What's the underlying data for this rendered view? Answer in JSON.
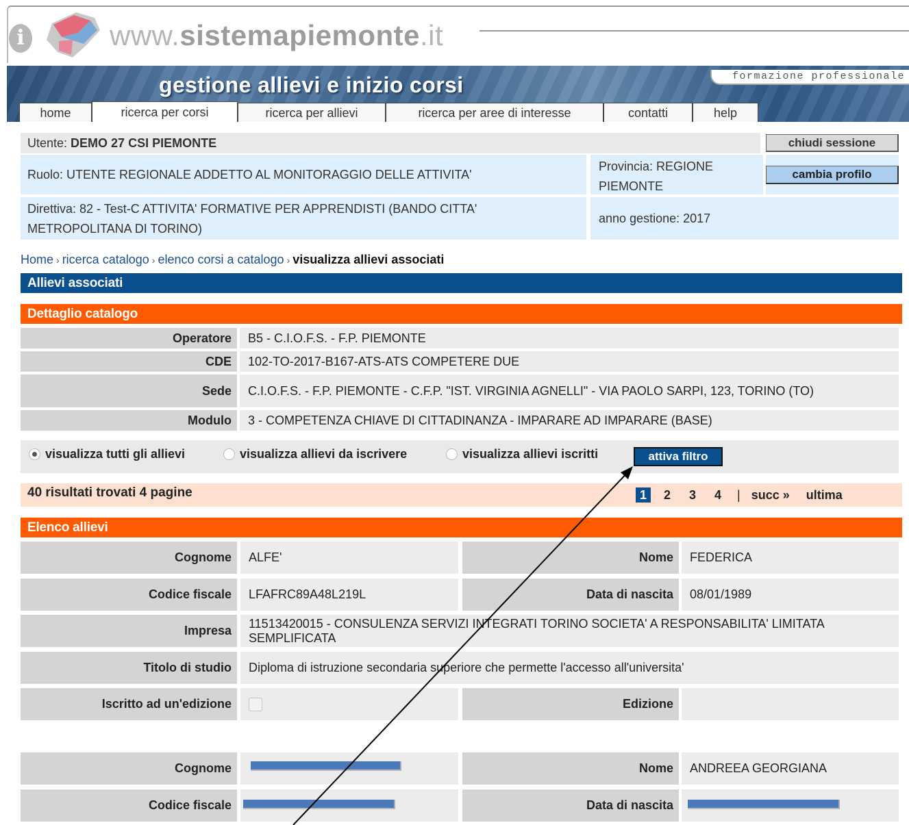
{
  "header": {
    "site_name_prefix": "www.",
    "site_name_bold": "sistemapiemonte",
    "site_name_suffix": ".it",
    "banner_title": "gestione allievi e inizio corsi",
    "banner_tag": "formazione professionale"
  },
  "tabs": [
    {
      "label": "home"
    },
    {
      "label": "ricerca per corsi"
    },
    {
      "label": "ricerca per allievi"
    },
    {
      "label": "ricerca per aree di interesse"
    },
    {
      "label": "contatti"
    },
    {
      "label": "help"
    }
  ],
  "user": {
    "utente_label": "Utente: ",
    "utente_value": "DEMO 27 CSI PIEMONTE",
    "chiudi_label": "chiudi sessione",
    "ruolo": "Ruolo: UTENTE REGIONALE ADDETTO AL MONITORAGGIO DELLE ATTIVITA'",
    "provincia": "Provincia: REGIONE PIEMONTE",
    "cambia_label": "cambia profilo",
    "direttiva": "Direttiva: 82 - Test-C ATTIVITA' FORMATIVE PER APPRENDISTI (BANDO CITTA' METROPOLITANA DI TORINO)",
    "anno": "anno gestione: 2017"
  },
  "breadcrumb": {
    "home": "Home",
    "ricerca": "ricerca catalogo",
    "elenco": "elenco corsi a catalogo",
    "current": "visualizza allievi associati",
    "sep": "›"
  },
  "sections": {
    "allievi_associati": "Allievi associati",
    "dettaglio_catalogo": "Dettaglio catalogo",
    "elenco_allievi": "Elenco allievi"
  },
  "detail": {
    "operatore_label": "Operatore",
    "operatore_value": "B5 - C.I.O.F.S. - F.P. PIEMONTE",
    "cde_label": "CDE",
    "cde_value": "102-TO-2017-B167-ATS-ATS COMPETERE DUE",
    "sede_label": "Sede",
    "sede_value": "C.I.O.F.S. - F.P. PIEMONTE - C.F.P. \"IST. VIRGINIA AGNELLI\" - VIA PAOLO SARPI, 123, TORINO (TO)",
    "modulo_label": "Modulo",
    "modulo_value": "3 - COMPETENZA CHIAVE DI CITTADINANZA - IMPARARE AD IMPARARE (BASE)"
  },
  "filter": {
    "opt_tutti": "visualizza tutti gli allievi",
    "opt_da_iscrivere": "visualizza allievi da iscrivere",
    "opt_iscritti": "visualizza allievi iscritti",
    "selected": "tutti",
    "button": "attiva filtro"
  },
  "results": {
    "text": "40 risultati trovati 4  pagine",
    "pages": [
      "1",
      "2",
      "3",
      "4"
    ],
    "current_page": "1",
    "sep": "|",
    "next": "succ »",
    "last": "ultima"
  },
  "labels": {
    "cognome": "Cognome",
    "nome": "Nome",
    "codice_fiscale": "Codice fiscale",
    "data_nascita": "Data di nascita",
    "impresa": "Impresa",
    "titolo_studio": "Titolo di studio",
    "iscritto": "Iscritto ad un'edizione",
    "edizione": "Edizione"
  },
  "students": [
    {
      "cognome": "ALFE'",
      "nome": "FEDERICA",
      "codice_fiscale": "LFAFRC89A48L219L",
      "data_nascita": "08/01/1989",
      "impresa": "11513420015 - CONSULENZA SERVIZI INTEGRATI TORINO SOCIETA' A RESPONSABILITA' LIMITATA SEMPLIFICATA",
      "titolo_studio": "Diploma di istruzione secondaria superiore che permette l'accesso all'universita'",
      "iscritto": false,
      "edizione": ""
    },
    {
      "cognome": "",
      "nome": "ANDREEA GEORGIANA",
      "codice_fiscale": "",
      "data_nascita": ""
    }
  ],
  "colors": {
    "blue_bar": "#0a4f8e",
    "orange_bar": "#ff5a00",
    "results_bg": "#fde0d0",
    "info_blue": "#dfeefb"
  }
}
